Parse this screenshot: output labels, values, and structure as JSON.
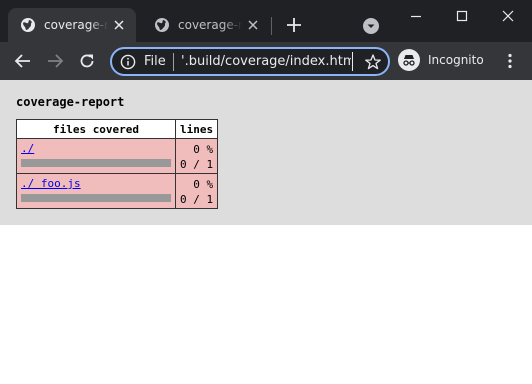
{
  "browser": {
    "tabs": [
      {
        "title": "coverage-report",
        "active": true,
        "icon": "globe-icon"
      },
      {
        "title": "coverage-report",
        "active": false,
        "icon": "globe-icon"
      }
    ],
    "omnibox": {
      "scheme_label": "File",
      "url": "'.build/coverage/index.html"
    },
    "incognito_label": "Incognito",
    "colors": {
      "frame": "#202124",
      "toolbar": "#35363a",
      "accent": "#8ab4f8"
    }
  },
  "page": {
    "title": "coverage-report",
    "table": {
      "headers": [
        "files covered",
        "lines"
      ],
      "rows": [
        {
          "file": "./",
          "percent": "0 %",
          "lines": "0 / 1",
          "coverage_fraction": 0
        },
        {
          "file": "./ foo.js",
          "percent": "0 %",
          "lines": "0 / 1",
          "coverage_fraction": 0
        }
      ]
    },
    "colors": {
      "background": "#dddddd",
      "row_uncovered": "#f0bcbc",
      "bar_track": "#999999",
      "link": "#0000ee"
    }
  }
}
